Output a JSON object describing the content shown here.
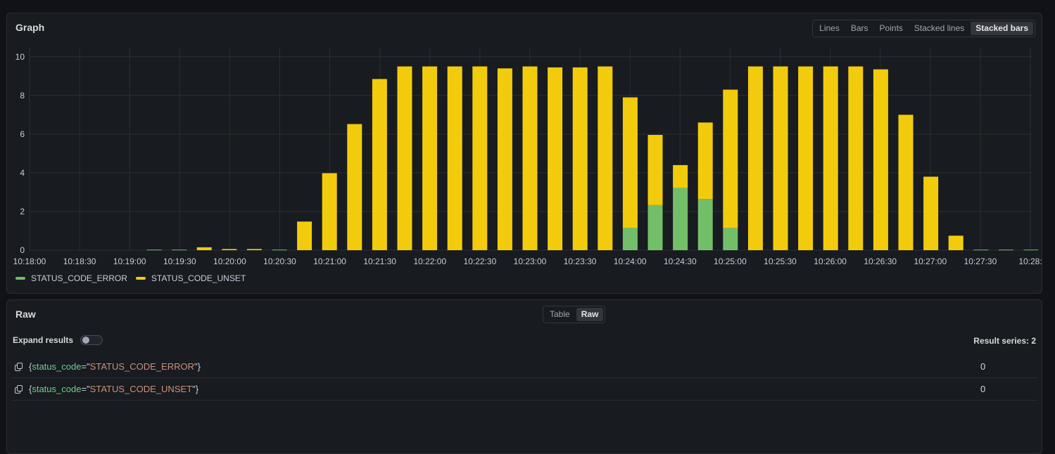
{
  "graph_panel": {
    "title": "Graph",
    "view_options": [
      "Lines",
      "Bars",
      "Points",
      "Stacked lines",
      "Stacked bars"
    ],
    "active_view": "Stacked bars"
  },
  "legend": [
    {
      "name": "STATUS_CODE_ERROR",
      "color": "#73bf69"
    },
    {
      "name": "STATUS_CODE_UNSET",
      "color": "#f2cc0c"
    }
  ],
  "chart_data": {
    "type": "bar",
    "stacked": true,
    "x_tick_labels": [
      "10:18:00",
      "10:18:30",
      "10:19:00",
      "10:19:30",
      "10:20:00",
      "10:20:30",
      "10:21:00",
      "10:21:30",
      "10:22:00",
      "10:22:30",
      "10:23:00",
      "10:23:30",
      "10:24:00",
      "10:24:30",
      "10:25:00",
      "10:25:30",
      "10:26:00",
      "10:26:30",
      "10:27:00",
      "10:27:30",
      "10:28:"
    ],
    "y_ticks": [
      0,
      2,
      4,
      6,
      8,
      10
    ],
    "ylim": [
      0,
      10.5
    ],
    "categories": [
      "10:19:15",
      "10:19:30",
      "10:19:45",
      "10:20:00",
      "10:20:15",
      "10:20:30",
      "10:20:45",
      "10:21:00",
      "10:21:15",
      "10:21:30",
      "10:21:45",
      "10:22:00",
      "10:22:15",
      "10:22:30",
      "10:22:45",
      "10:23:00",
      "10:23:15",
      "10:23:30",
      "10:23:45",
      "10:24:00",
      "10:24:15",
      "10:24:30",
      "10:24:45",
      "10:25:00",
      "10:25:15",
      "10:25:30",
      "10:25:45",
      "10:26:00",
      "10:26:15",
      "10:26:30",
      "10:26:45",
      "10:27:00",
      "10:27:15",
      "10:27:30",
      "10:27:45",
      "10:28:00"
    ],
    "series": [
      {
        "name": "STATUS_CODE_ERROR",
        "color": "#73bf69",
        "values": [
          0.03,
          0.03,
          0,
          0,
          0,
          0.03,
          0,
          0,
          0,
          0,
          0,
          0,
          0,
          0,
          0,
          0,
          0,
          0,
          0,
          1.15,
          2.33,
          3.22,
          2.65,
          1.15,
          0,
          0,
          0,
          0,
          0,
          0,
          0,
          0,
          0,
          0.03,
          0.03,
          0.03
        ]
      },
      {
        "name": "STATUS_CODE_UNSET",
        "color": "#f2cc0c",
        "values": [
          0,
          0,
          0.15,
          0.06,
          0.06,
          0,
          1.48,
          3.98,
          6.52,
          8.85,
          9.5,
          9.5,
          9.5,
          9.5,
          9.4,
          9.5,
          9.45,
          9.45,
          9.5,
          6.75,
          3.63,
          1.18,
          3.95,
          7.15,
          9.5,
          9.5,
          9.5,
          9.5,
          9.5,
          9.35,
          7.0,
          3.8,
          0.75,
          0,
          0,
          0
        ]
      }
    ]
  },
  "raw_panel": {
    "title": "Raw",
    "view_options": [
      "Table",
      "Raw"
    ],
    "active_view": "Raw",
    "expand_label": "Expand results",
    "result_series_label": "Result series: 2",
    "rows": [
      {
        "open": "{",
        "label": "status_code",
        "eq": "=",
        "q1": "\"",
        "value": "STATUS_CODE_ERROR",
        "q2": "\"",
        "close": "}",
        "result": "0"
      },
      {
        "open": "{",
        "label": "status_code",
        "eq": "=",
        "q1": "\"",
        "value": "STATUS_CODE_UNSET",
        "q2": "\"",
        "close": "}",
        "result": "0"
      }
    ]
  }
}
